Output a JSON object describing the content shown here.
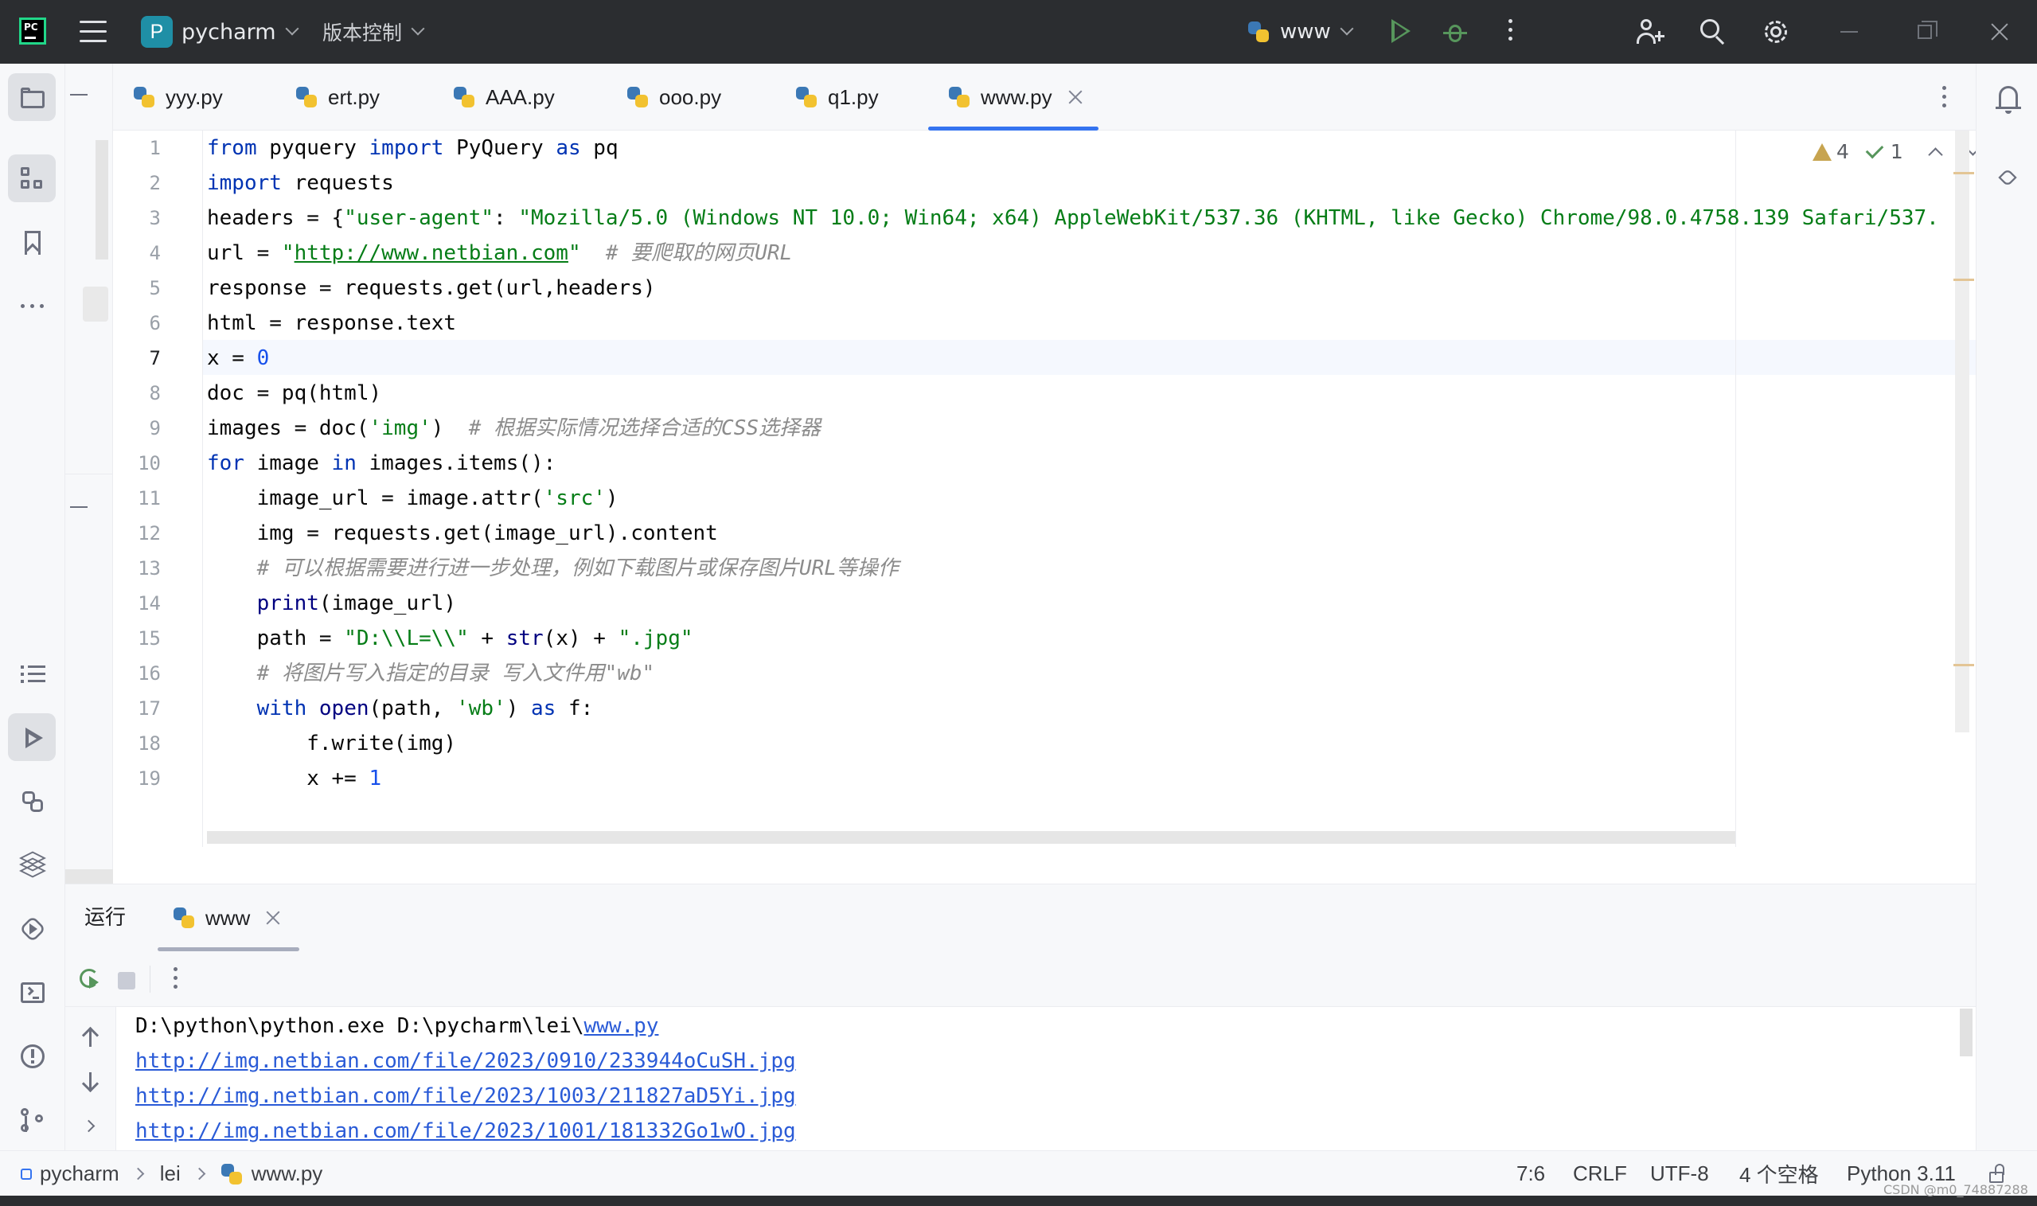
{
  "titlebar": {
    "project_badge": "P",
    "project_name": "pycharm",
    "vcs_label": "版本控制",
    "run_config": "www"
  },
  "tabs": [
    {
      "label": "yyy.py"
    },
    {
      "label": "ert.py"
    },
    {
      "label": "AAA.py"
    },
    {
      "label": "ooo.py"
    },
    {
      "label": "q1.py"
    },
    {
      "label": "www.py",
      "active": true
    }
  ],
  "editor": {
    "inspections": {
      "warnings": "4",
      "weak_warnings": "1"
    },
    "current_line": 7,
    "lines": [
      "1",
      "2",
      "3",
      "4",
      "5",
      "6",
      "7",
      "8",
      "9",
      "10",
      "11",
      "12",
      "13",
      "14",
      "15",
      "16",
      "17",
      "18",
      "19"
    ],
    "code": {
      "l1": {
        "kw1": "from",
        "t1": " pyquery ",
        "kw2": "import",
        "t2": " PyQuery ",
        "kw3": "as",
        "t3": " pq"
      },
      "l2": {
        "kw1": "import",
        "t1": " requests"
      },
      "l3": {
        "t1": "headers = {",
        "s1": "\"user-agent\"",
        "t2": ": ",
        "s2": "\"Mozilla/5.0 (Windows NT 10.0; Win64; x64) AppleWebKit/537.36 (KHTML, like Gecko) Chrome/98.0.4758.139 Safari/537."
      },
      "l4": {
        "t1": "url = ",
        "s1": "\"",
        "u1": "http://www.netbian.com",
        "s2": "\"",
        "c1": "  # 要爬取的网页URL"
      },
      "l5": {
        "t1": "response = requests.get(url,headers)"
      },
      "l6": {
        "t1": "html = response.text"
      },
      "l7": {
        "t1": "x = ",
        "n1": "0"
      },
      "l8": {
        "t1": "doc = pq(html)"
      },
      "l9": {
        "t1": "images = doc(",
        "s1": "'img'",
        "t2": ")",
        "c1": "  # 根据实际情况选择合适的CSS选择器"
      },
      "l10": {
        "kw1": "for",
        "t1": " image ",
        "kw2": "in",
        "t2": " images.items():"
      },
      "l11": {
        "t1": "    image_url = image.attr(",
        "s1": "'src'",
        "t2": ")"
      },
      "l12": {
        "t1": "    img = requests.get(image_url).content"
      },
      "l13": {
        "c1": "    # 可以根据需要进行进一步处理，例如下载图片或保存图片URL等操作"
      },
      "l14": {
        "b1": "    print",
        "t1": "(image_url)"
      },
      "l15": {
        "t1": "    path = ",
        "s1": "\"D:\\\\L=\\\\\"",
        "t2": " + ",
        "b1": "str",
        "t3": "(x) + ",
        "s2": "\".jpg\""
      },
      "l16": {
        "c1": "    # 将图片写入指定的目录 写入文件用\"wb\""
      },
      "l17": {
        "kw1": "    with",
        "t1": " ",
        "b1": "open",
        "t2": "(path, ",
        "s1": "'wb'",
        "t3": ") ",
        "kw2": "as",
        "t4": " f:"
      },
      "l18": {
        "t1": "        f.write(img)"
      },
      "l19": {
        "t1": "        x += ",
        "n1": "1"
      }
    }
  },
  "run_panel": {
    "title": "运行",
    "tab_label": "www",
    "console": {
      "cmd_prefix": "D:\\python\\python.exe D:\\pycharm\\lei\\",
      "cmd_link": "www.py",
      "links": [
        "http://img.netbian.com/file/2023/0910/233944oCuSH.jpg",
        "http://img.netbian.com/file/2023/1003/211827aD5Yi.jpg",
        "http://img.netbian.com/file/2023/1001/181332Go1wO.jpg"
      ]
    }
  },
  "statusbar": {
    "breadcrumb": [
      "pycharm",
      "lei",
      "www.py"
    ],
    "position": "7:6",
    "line_sep": "CRLF",
    "encoding": "UTF-8",
    "indent": "4 个空格",
    "interpreter": "Python 3.11"
  },
  "watermark": "CSDN @m0_74887288",
  "colors": {
    "accent": "#3574f0",
    "run_green": "#57965c",
    "keyword": "#0033b3",
    "string": "#067d17",
    "number": "#1750eb",
    "comment": "#8c8c8c"
  }
}
